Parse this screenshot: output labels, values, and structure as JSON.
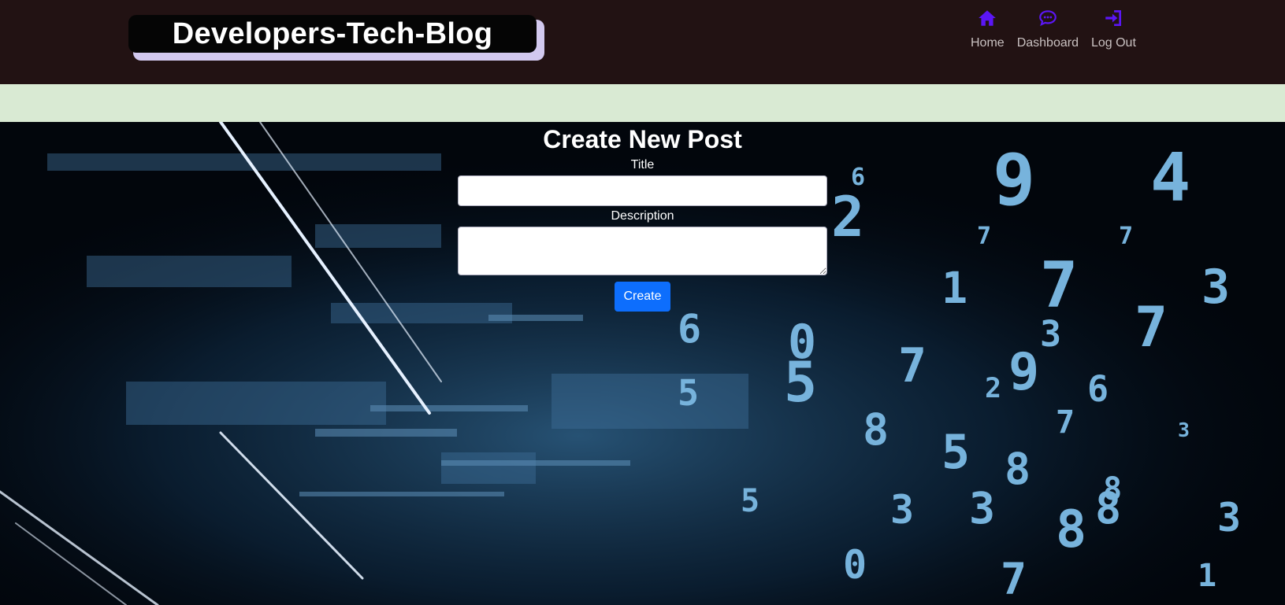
{
  "header": {
    "brand": "Developers-Tech-Blog",
    "nav": [
      {
        "label": "Home",
        "icon": "home-icon"
      },
      {
        "label": "Dashboard",
        "icon": "chat-icon"
      },
      {
        "label": "Log Out",
        "icon": "sign-in-icon"
      }
    ]
  },
  "form": {
    "heading": "Create New Post",
    "title_label": "Title",
    "title_value": "",
    "description_label": "Description",
    "description_value": "",
    "submit_label": "Create"
  },
  "colors": {
    "header_bg": "#221213",
    "band_bg": "#d9ead3",
    "nav_icon": "#5b16f5",
    "button": "#0d6efd"
  }
}
